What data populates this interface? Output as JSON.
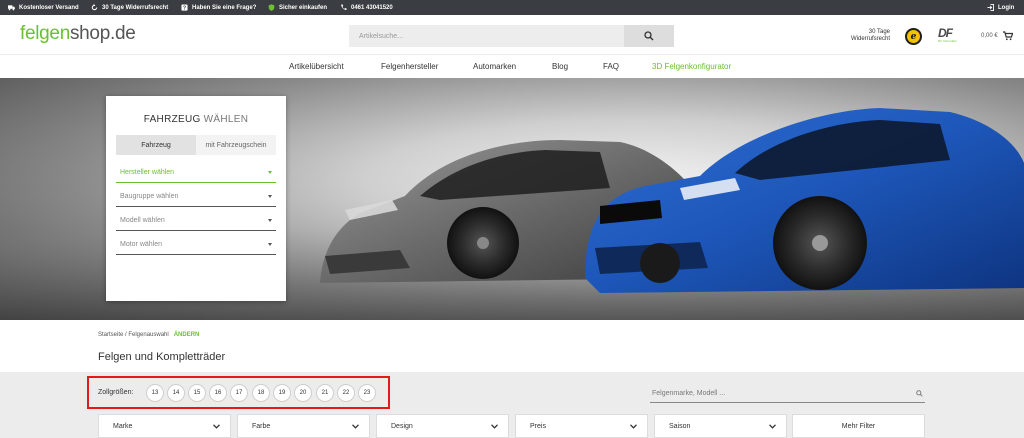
{
  "topbar": {
    "items": [
      {
        "label": "Kostenloser Versand",
        "icon": "truck-icon"
      },
      {
        "label": "30 Tage Widerrufsrecht",
        "icon": "return-arrow-icon"
      },
      {
        "label": "Haben Sie eine Frage?",
        "icon": "question-icon"
      },
      {
        "label": "Sicher einkaufen",
        "icon": "shield-icon"
      },
      {
        "label": "0461 43041520",
        "icon": "phone-icon"
      }
    ],
    "login_label": "Login"
  },
  "header": {
    "logo_prefix": "felgen",
    "logo_suffix": "shop.de",
    "search_placeholder": "Artikelsuche...",
    "widerruf_line1": "30 Tage",
    "widerruf_line2": "Widerrufsrecht",
    "trust_badge_letter": "e",
    "df_logo_text": "DF",
    "df_logo_sub": "DF FELGEN",
    "cart_amount": "0,00 €"
  },
  "nav": {
    "items": [
      "Artikelübersicht",
      "Felgenhersteller",
      "Automarken",
      "Blog",
      "FAQ",
      "3D Felgenkonfigurator"
    ]
  },
  "vehicle_panel": {
    "title_bold": "FAHRZEUG",
    "title_light": " WÄHLEN",
    "tab_vehicle": "Fahrzeug",
    "tab_registration": "mit Fahrzeugschein",
    "selects": [
      "Hersteller wählen",
      "Baugruppe wählen",
      "Modell wählen",
      "Motor wählen"
    ]
  },
  "breadcrumb": {
    "text": "Startseite / Felgenauswahl",
    "change_label": "ÄNDERN"
  },
  "page_title": "Felgen und Kompletträder",
  "filters": {
    "sizes_label": "Zollgrößen:",
    "sizes": [
      "13",
      "14",
      "15",
      "16",
      "17",
      "18",
      "19",
      "20",
      "21",
      "22",
      "23"
    ],
    "brand_search_placeholder": "Felgenmarke, Modell ...",
    "dropdowns": [
      "Marke",
      "Farbe",
      "Design",
      "Preis",
      "Saison"
    ],
    "more_label": "Mehr Filter"
  },
  "colors": {
    "accent": "#6bbf31",
    "topbar": "#3a3d42",
    "highlight": "#e21a1a"
  }
}
